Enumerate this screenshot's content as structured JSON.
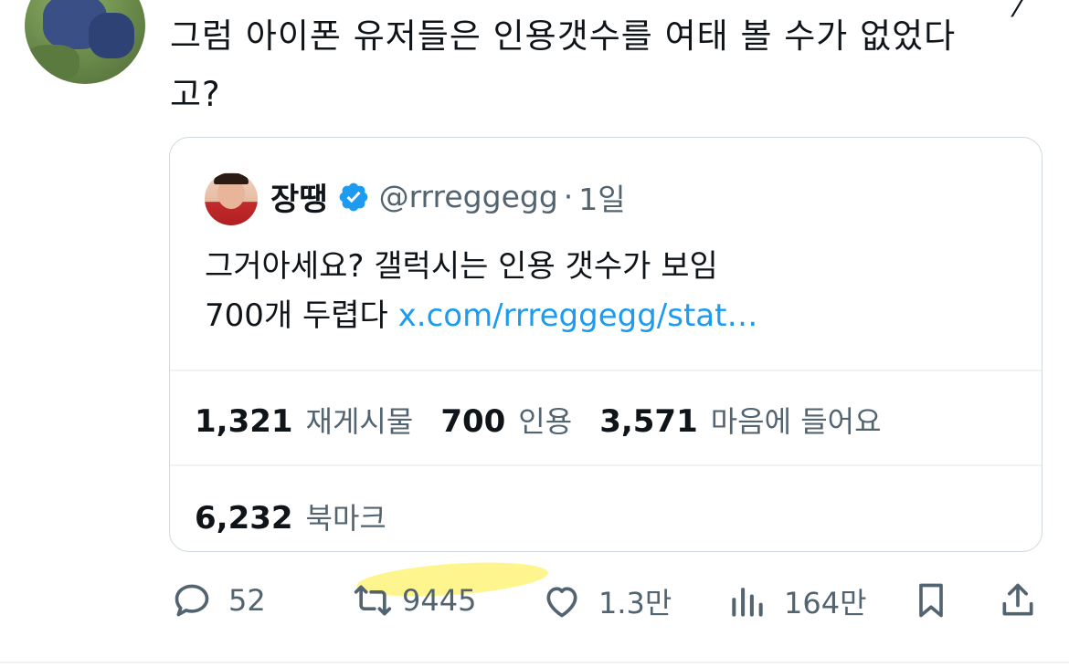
{
  "tweet": {
    "text_line1": "그럼 아이폰 유저들은 인용갯수를 여태 볼 수가 없었다",
    "text_line2": "고?"
  },
  "quote": {
    "name": "장땡",
    "handle": "@rrreggegg",
    "dot": "·",
    "time": "1일",
    "text_line1": "그거아세요? 갤럭시는 인용 갯수가 보임",
    "text_line2_prefix": "700개 두렵다 ",
    "link": "x.com/rrreggegg/stat…",
    "stats_row1": [
      {
        "num": "1,321",
        "label": "재게시물"
      },
      {
        "num": "700",
        "label": "인용"
      },
      {
        "num": "3,571",
        "label": "마음에 들어요"
      }
    ],
    "stats_row2": [
      {
        "num": "6,232",
        "label": "북마크"
      }
    ]
  },
  "actions": {
    "reply_count": "52",
    "repost_count": "9445",
    "like_count": "1.3만",
    "views_count": "164만"
  },
  "colors": {
    "link": "#1d9bf0",
    "secondary": "#536471",
    "border": "#cfd9de",
    "highlight": "#fff37a"
  }
}
